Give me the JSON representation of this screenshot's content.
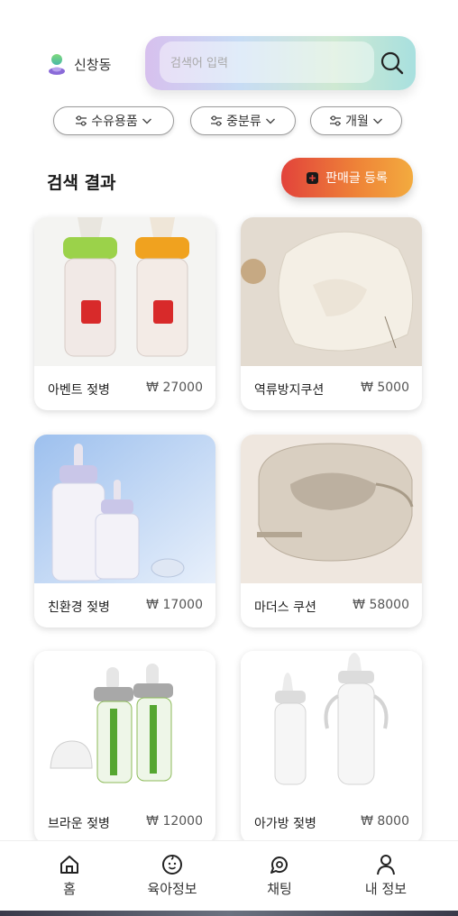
{
  "header": {
    "location": "신창동",
    "search_placeholder": "검색어 입력"
  },
  "filters": [
    {
      "label": "수유용품"
    },
    {
      "label": "중분류"
    },
    {
      "label": "개월"
    }
  ],
  "results": {
    "title": "검색 결과",
    "sell_button": "판매글 등록"
  },
  "products": [
    {
      "name": "아벤트 젖병",
      "price": "₩ 27000"
    },
    {
      "name": "역류방지쿠션",
      "price": "₩ 5000"
    },
    {
      "name": "친환경 젖병",
      "price": "₩ 17000"
    },
    {
      "name": "마더스 쿠션",
      "price": "₩ 58000"
    },
    {
      "name": "브라운 젖병",
      "price": "₩ 12000"
    },
    {
      "name": "아가방 젖병",
      "price": "₩ 8000"
    }
  ],
  "nav": [
    {
      "label": "홈",
      "icon": "home-icon"
    },
    {
      "label": "육아정보",
      "icon": "baby-face-icon"
    },
    {
      "label": "채팅",
      "icon": "chat-icon"
    },
    {
      "label": "내 정보",
      "icon": "person-icon"
    }
  ],
  "colors": {
    "sell_button_start": "#e2433b",
    "sell_button_end": "#f3ab3f",
    "location_pin": "#6fcf7a"
  }
}
